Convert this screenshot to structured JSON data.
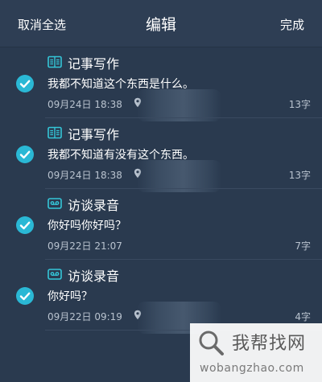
{
  "header": {
    "cancel_select_all": "取消全选",
    "title": "编辑",
    "done": "完成"
  },
  "items": [
    {
      "category": "记事写作",
      "category_icon": "notebook-icon",
      "content": "我都不知道这个东西是什么。",
      "date": "09月24日 18:38",
      "has_location": true,
      "count": "13字",
      "checked": true
    },
    {
      "category": "记事写作",
      "category_icon": "notebook-icon",
      "content": "我都不知道有没有这个东西。",
      "date": "09月24日 18:38",
      "has_location": true,
      "count": "13字",
      "checked": true
    },
    {
      "category": "访谈录音",
      "category_icon": "cassette-icon",
      "content": "你好吗你好吗？",
      "date": "09月22日 21:07",
      "has_location": false,
      "count": "7字",
      "checked": true
    },
    {
      "category": "访谈录音",
      "category_icon": "cassette-icon",
      "content": "你好吗？",
      "date": "09月22日 09:19",
      "has_location": true,
      "count": "4字",
      "checked": true
    }
  ],
  "watermark": {
    "text": "我帮找网",
    "url": "wobangzhao.com"
  },
  "colors": {
    "background": "#2a3a4f",
    "header": "#2e3e54",
    "accent": "#2ab8d5",
    "category_icon": "#34c6d8",
    "secondary_text": "#b9c3cf"
  }
}
